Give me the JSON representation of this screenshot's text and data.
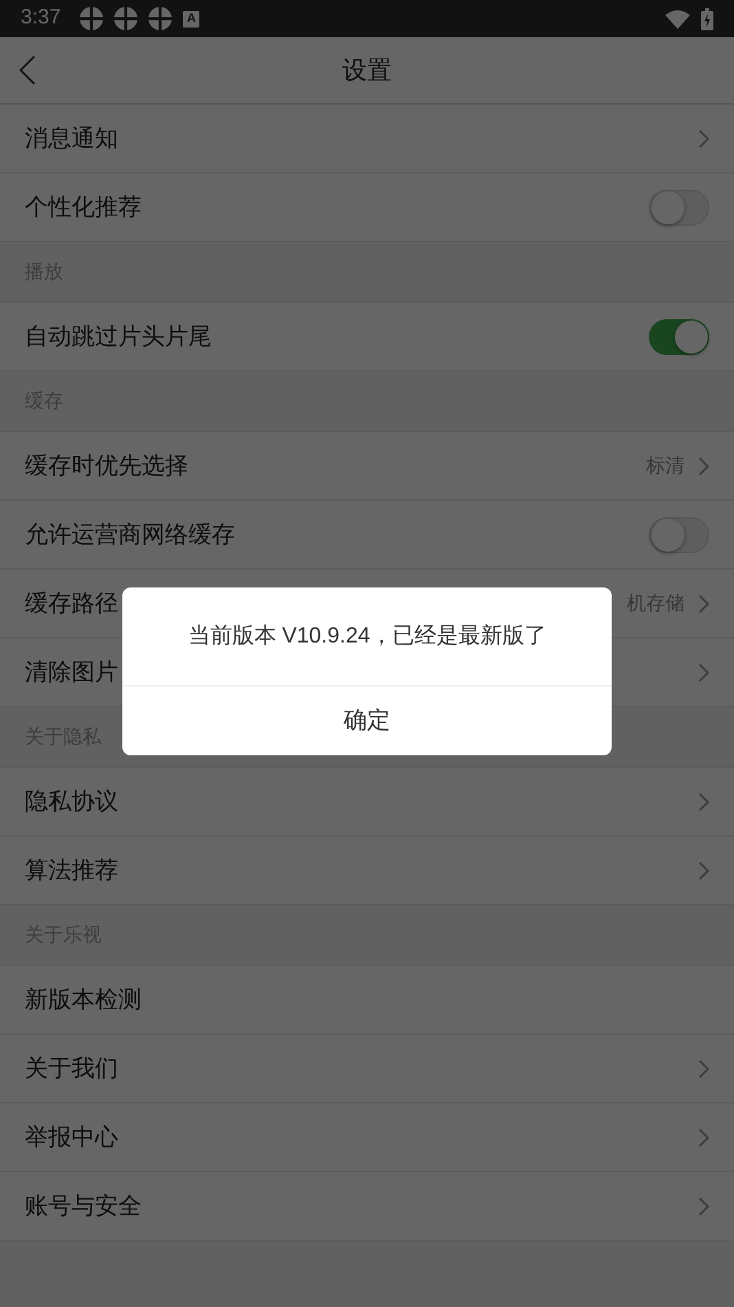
{
  "status_bar": {
    "time": "3:37",
    "notification_icons": [
      "A"
    ]
  },
  "header": {
    "title": "设置"
  },
  "sections": [
    {
      "items": [
        {
          "kind": "link",
          "label": "消息通知"
        },
        {
          "kind": "toggle",
          "label": "个性化推荐",
          "on": false
        }
      ]
    },
    {
      "title": "播放",
      "items": [
        {
          "kind": "toggle",
          "label": "自动跳过片头片尾",
          "on": true
        }
      ]
    },
    {
      "title": "缓存",
      "items": [
        {
          "kind": "link",
          "label": "缓存时优先选择",
          "value": "标清"
        },
        {
          "kind": "toggle",
          "label": "允许运营商网络缓存",
          "on": false
        },
        {
          "kind": "link",
          "label": "缓存路径",
          "value": "机存储"
        },
        {
          "kind": "link",
          "label": "清除图片"
        }
      ]
    },
    {
      "title": "关于隐私",
      "items": [
        {
          "kind": "link",
          "label": "隐私协议"
        },
        {
          "kind": "link",
          "label": "算法推荐"
        }
      ]
    },
    {
      "title": "关于乐视",
      "items": [
        {
          "kind": "plain",
          "label": "新版本检测"
        },
        {
          "kind": "link",
          "label": "关于我们"
        },
        {
          "kind": "link",
          "label": "举报中心"
        },
        {
          "kind": "link",
          "label": "账号与安全"
        }
      ]
    }
  ],
  "dialog": {
    "message": "当前版本 V10.9.24，已经是最新版了",
    "button": "确定"
  }
}
